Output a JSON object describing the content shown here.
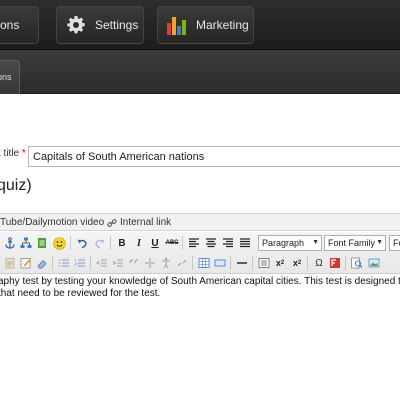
{
  "nav": {
    "prev_label": "ons",
    "settings_label": "Settings",
    "marketing_label": "Marketing"
  },
  "subbar": {
    "tab_label": "ons"
  },
  "form": {
    "title_label": "t title",
    "required_mark": "*",
    "title_value": "Capitals of South American nations",
    "type_heading": "quiz)"
  },
  "editor": {
    "tabs": {
      "video": "Tube/Dailymotion video",
      "internal_link": "Internal link"
    },
    "toolbar": {
      "format_select": "Paragraph",
      "font_family_select": "Font Family",
      "font_size_select": "Fo",
      "bold": "B",
      "italic": "I",
      "underline": "U",
      "strike": "ABC"
    },
    "content_lines": [
      "aphy test by testing your knowledge of South American capital cities. This test is designed to h",
      "that need to be reviewed for the test."
    ]
  },
  "colors": {
    "nav_bg": "#1c1c1c",
    "required": "#cc0000",
    "marketing_icon": [
      "#e23b3b",
      "#f2a61f",
      "#3a7bd5",
      "#7ab800"
    ]
  }
}
